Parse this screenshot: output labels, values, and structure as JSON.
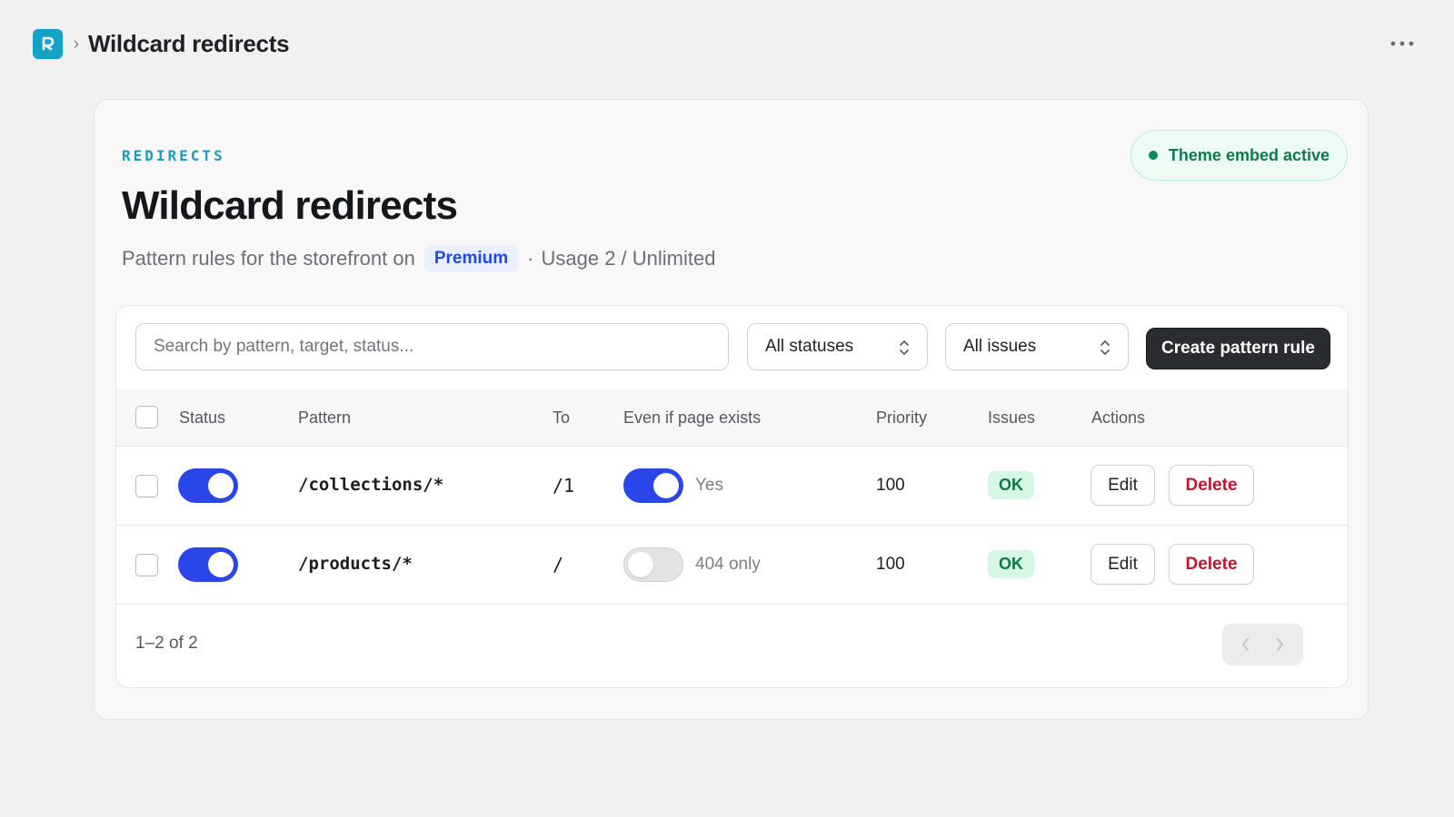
{
  "header": {
    "title": "Wildcard redirects",
    "breadcrumb_sep": "›",
    "logo_icon": "logo-icon",
    "more_icon": "more-horizontal-icon"
  },
  "hero": {
    "eyebrow": "REDIRECTS",
    "title": "Wildcard redirects",
    "subtitle_prefix": "Pattern rules for the storefront on",
    "plan": "Premium",
    "usage_sep": "·",
    "usage": "Usage 2 / Unlimited",
    "embed_status": "Theme embed active"
  },
  "toolbar": {
    "search_placeholder": "Search by pattern, target, status...",
    "status_filter": "All statuses",
    "issues_filter": "All issues",
    "create_label": "Create pattern rule"
  },
  "table": {
    "columns": [
      "Status",
      "Pattern",
      "To",
      "Even if page exists",
      "Priority",
      "Issues",
      "Actions"
    ],
    "rows": [
      {
        "enabled": true,
        "pattern": "/collections/*",
        "to": "/1",
        "even_if_exists": true,
        "exists_label": "Yes",
        "priority": "100",
        "issues": "OK",
        "edit_label": "Edit",
        "delete_label": "Delete"
      },
      {
        "enabled": true,
        "pattern": "/products/*",
        "to": "/",
        "even_if_exists": false,
        "exists_label": "404 only",
        "priority": "100",
        "issues": "OK",
        "edit_label": "Edit",
        "delete_label": "Delete"
      }
    ]
  },
  "footer": {
    "count": "1–2 of 2",
    "prev_icon": "chevron-left-icon",
    "next_icon": "chevron-right-icon"
  },
  "colors": {
    "accent": "#2a45e8",
    "brand": "#14a3c7",
    "success": "#0b7a47",
    "danger": "#c2132f"
  }
}
